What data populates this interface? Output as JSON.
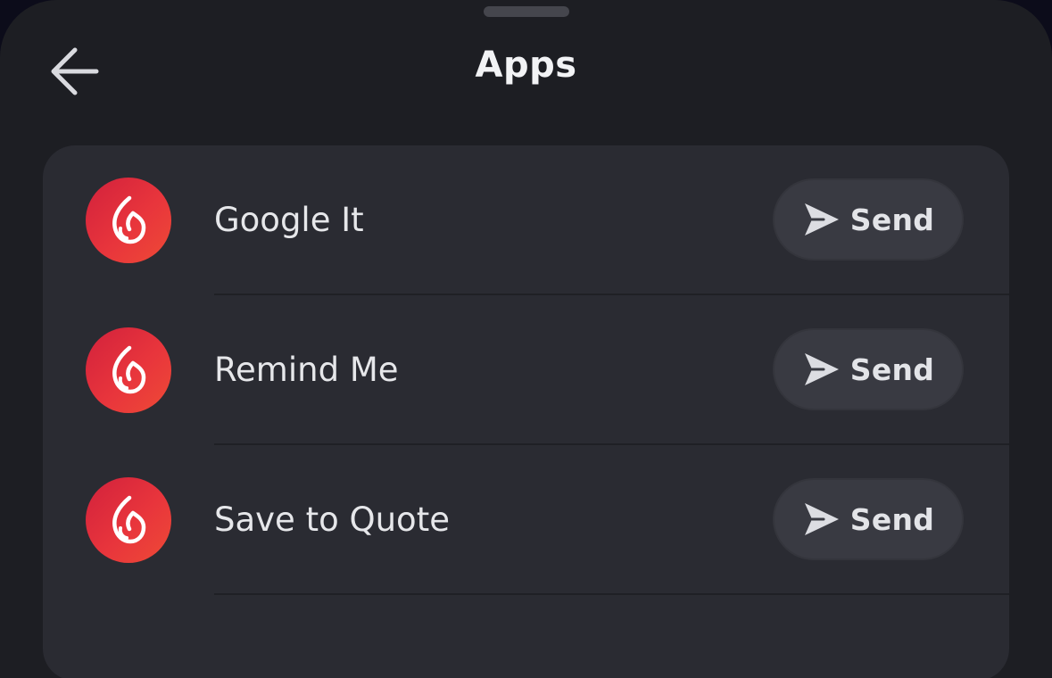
{
  "header": {
    "title": "Apps"
  },
  "apps": [
    {
      "name": "Google It",
      "action_label": "Send"
    },
    {
      "name": "Remind Me",
      "action_label": "Send"
    },
    {
      "name": "Save to Quote",
      "action_label": "Send"
    }
  ],
  "colors": {
    "sheet_background": "#1d1e23",
    "card_background": "#2a2b32",
    "app_icon_red": "#e8353c",
    "button_background": "#393a42",
    "text_primary": "#f2f3f5"
  },
  "icons": {
    "back": "arrow-left-icon",
    "app": "flame-icon",
    "send": "paper-plane-icon"
  }
}
